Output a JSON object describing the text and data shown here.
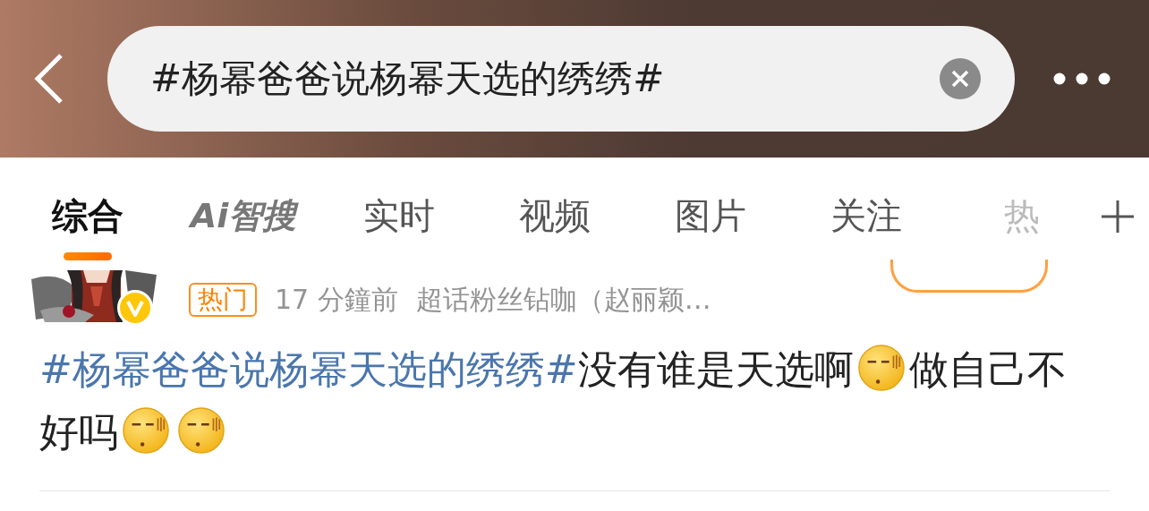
{
  "search": {
    "value": "#杨幂爸爸说杨幂天选的绣绣#"
  },
  "tabs": [
    {
      "label": "综合",
      "kind": "text",
      "selected": true
    },
    {
      "label": "Ai智搜",
      "kind": "logo",
      "selected": false
    },
    {
      "label": "实时",
      "kind": "text",
      "selected": false
    },
    {
      "label": "视频",
      "kind": "text",
      "selected": false
    },
    {
      "label": "图片",
      "kind": "text",
      "selected": false
    },
    {
      "label": "关注",
      "kind": "text",
      "selected": false
    },
    {
      "label": "热",
      "kind": "faded",
      "selected": false
    }
  ],
  "post": {
    "verified": true,
    "tag": "热门",
    "time": "17 分鐘前",
    "source": "超话粉丝钻咖（赵丽颖…",
    "content": [
      {
        "kind": "topic",
        "text": "#杨幂爸爸说杨幂天选的绣绣#"
      },
      {
        "kind": "text",
        "text": "没有谁是天选啊"
      },
      {
        "kind": "emoji"
      },
      {
        "kind": "text",
        "text": "做自己不好吗"
      },
      {
        "kind": "emoji"
      },
      {
        "kind": "emoji"
      }
    ]
  }
}
